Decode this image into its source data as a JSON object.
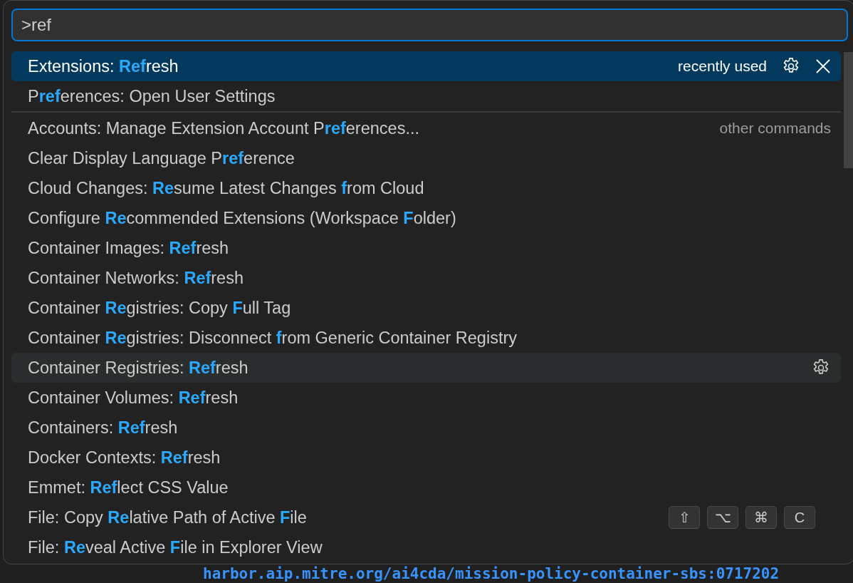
{
  "background": {
    "editor_text": "harbor.aip.mitre.org/ai4cda/mission-policy-container-sbs:0717202"
  },
  "palette": {
    "input": {
      "value": ">ref"
    },
    "items": [
      {
        "label": "Extensions: **Ref**resh",
        "selected": true,
        "hovered": false,
        "description": "recently used",
        "actions": [
          {
            "kind": "gear"
          },
          {
            "kind": "close"
          }
        ],
        "separator_after": false
      },
      {
        "label": "P**ref**erences: Open User Settings",
        "selected": false,
        "hovered": false,
        "separator_after": true
      },
      {
        "label": "Accounts: Manage Extension Account P**ref**erences...",
        "selected": false,
        "hovered": false,
        "description": "other commands",
        "separator_after": false
      },
      {
        "label": "Clear Display Language P**ref**erence",
        "selected": false,
        "hovered": false,
        "separator_after": false
      },
      {
        "label": "Cloud Changes: **Re**sume Latest Changes **f**rom Cloud",
        "selected": false,
        "hovered": false,
        "separator_after": false
      },
      {
        "label": "Configure **Re**commended Extensions (Workspace **F**older)",
        "selected": false,
        "hovered": false,
        "separator_after": false
      },
      {
        "label": "Container Images: **Ref**resh",
        "selected": false,
        "hovered": false,
        "separator_after": false
      },
      {
        "label": "Container Networks: **Ref**resh",
        "selected": false,
        "hovered": false,
        "separator_after": false
      },
      {
        "label": "Container **Re**gistries: Copy **F**ull Tag",
        "selected": false,
        "hovered": false,
        "separator_after": false
      },
      {
        "label": "Container **Re**gistries: Disconnect **f**rom Generic Container Registry",
        "selected": false,
        "hovered": false,
        "separator_after": false
      },
      {
        "label": "Container Registries: **Ref**resh",
        "selected": false,
        "hovered": true,
        "actions": [
          {
            "kind": "gear"
          }
        ],
        "separator_after": false
      },
      {
        "label": "Container Volumes: **Ref**resh",
        "selected": false,
        "hovered": false,
        "separator_after": false
      },
      {
        "label": "Containers: **Ref**resh",
        "selected": false,
        "hovered": false,
        "separator_after": false
      },
      {
        "label": "Docker Contexts: **Ref**resh",
        "selected": false,
        "hovered": false,
        "separator_after": false
      },
      {
        "label": "Emmet: **Ref**lect CSS Value",
        "selected": false,
        "hovered": false,
        "separator_after": false
      },
      {
        "label": "File: Copy **Re**lative Path of Active **F**ile",
        "selected": false,
        "hovered": false,
        "keybinding": [
          "⇧",
          "⌥",
          "⌘",
          "C"
        ],
        "separator_after": false
      },
      {
        "label": "File: **Re**veal Active **F**ile in Explorer View",
        "selected": false,
        "hovered": false,
        "separator_after": false
      }
    ]
  }
}
